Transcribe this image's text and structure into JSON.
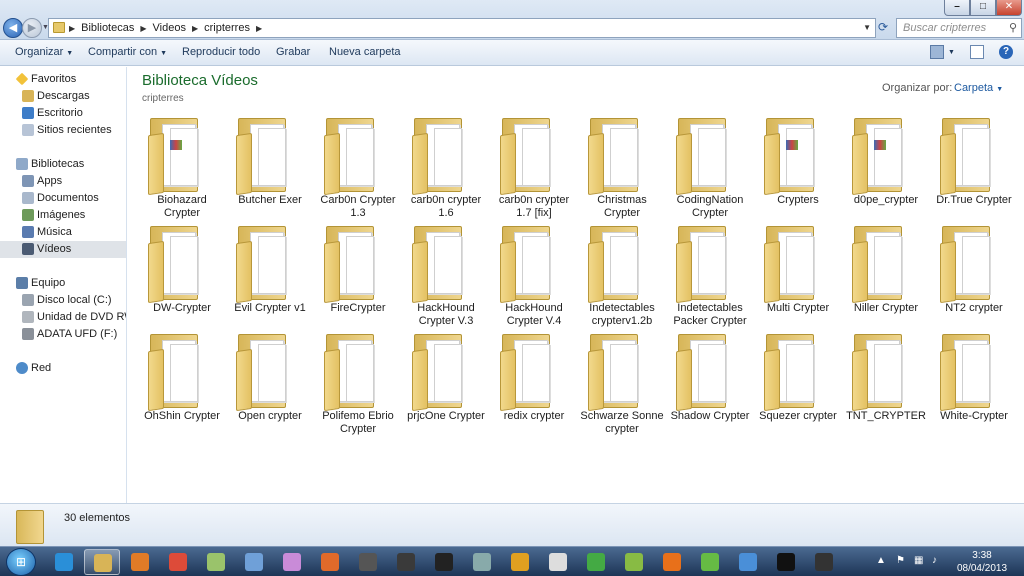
{
  "window": {
    "breadcrumb": [
      "Bibliotecas",
      "Videos",
      "cripterres"
    ],
    "search_placeholder": "Buscar cripterres",
    "controls": {
      "minimize": "–",
      "maximize": "□",
      "close": "✕"
    }
  },
  "toolbar": {
    "organize": "Organizar",
    "share": "Compartir con",
    "play_all": "Reproducir todo",
    "burn": "Grabar",
    "new_folder": "Nueva carpeta"
  },
  "nav": {
    "favorites_header": "Favoritos",
    "favorites": [
      "Descargas",
      "Escritorio",
      "Sitios recientes"
    ],
    "libraries_header": "Bibliotecas",
    "libraries": [
      "Apps",
      "Documentos",
      "Imágenes",
      "Música",
      "Vídeos"
    ],
    "computer_header": "Equipo",
    "drives": [
      "Disco local (C:)",
      "Unidad de DVD RW (",
      "ADATA UFD (F:)"
    ],
    "network": "Red"
  },
  "library": {
    "title": "Biblioteca Vídeos",
    "subtitle": "cripterres",
    "arrange_label": "Organizar por:",
    "arrange_value": "Carpeta"
  },
  "folders": [
    {
      "line1": "Biohazard",
      "line2": "Crypter",
      "thumb": "image"
    },
    {
      "line1": "Butcher Exer",
      "line2": "",
      "thumb": "docs"
    },
    {
      "line1": "Carb0n Crypter",
      "line2": "1.3",
      "thumb": "docs"
    },
    {
      "line1": "carb0n crypter",
      "line2": "1.6",
      "thumb": "docs"
    },
    {
      "line1": "carb0n crypter",
      "line2": "1.7 [fix]",
      "thumb": "docs"
    },
    {
      "line1": "Christmas",
      "line2": "Crypter",
      "thumb": "docs"
    },
    {
      "line1": "CodingNation",
      "line2": "Crypter",
      "thumb": "docs"
    },
    {
      "line1": "Crypters",
      "line2": "",
      "thumb": "image"
    },
    {
      "line1": "d0pe_crypter",
      "line2": "",
      "thumb": "image"
    },
    {
      "line1": "Dr.True Crypter",
      "line2": "",
      "thumb": "docs"
    },
    {
      "line1": "DW-Crypter",
      "line2": "",
      "thumb": "docs"
    },
    {
      "line1": "Evil Crypter v1",
      "line2": "",
      "thumb": "docs"
    },
    {
      "line1": "FireCrypter",
      "line2": "",
      "thumb": "docs"
    },
    {
      "line1": "HackHound",
      "line2": "Crypter V.3",
      "thumb": "blank"
    },
    {
      "line1": "HackHound",
      "line2": "Crypter V.4",
      "thumb": "blank"
    },
    {
      "line1": "Indetectables",
      "line2": "crypterv1.2b",
      "thumb": "docs"
    },
    {
      "line1": "Indetectables",
      "line2": "Packer Crypter",
      "thumb": "docs"
    },
    {
      "line1": "Multi Crypter",
      "line2": "",
      "thumb": "docs"
    },
    {
      "line1": "Niller Crypter",
      "line2": "",
      "thumb": "blank"
    },
    {
      "line1": "NT2 crypter",
      "line2": "",
      "thumb": "docs"
    },
    {
      "line1": "OhShin Crypter",
      "line2": "",
      "thumb": "docs"
    },
    {
      "line1": "Open crypter",
      "line2": "",
      "thumb": "blank"
    },
    {
      "line1": "Polifemo Ebrio",
      "line2": "Crypter",
      "thumb": "docs"
    },
    {
      "line1": "prjcOne Crypter",
      "line2": "",
      "thumb": "blank"
    },
    {
      "line1": "redix crypter",
      "line2": "",
      "thumb": "blank"
    },
    {
      "line1": "Schwarze Sonne",
      "line2": "crypter",
      "thumb": "blank"
    },
    {
      "line1": "Shadow Crypter",
      "line2": "",
      "thumb": "docs"
    },
    {
      "line1": "Squezer crypter",
      "line2": "",
      "thumb": "docs"
    },
    {
      "line1": "TNT_CRYPTER",
      "line2": "",
      "thumb": "docs"
    },
    {
      "line1": "White-Crypter",
      "line2": "",
      "thumb": "docs"
    }
  ],
  "status": {
    "count": "30 elementos"
  },
  "taskbar": {
    "apps": [
      "ie-icon",
      "explorer-icon",
      "media-player-icon",
      "chrome-icon",
      "notes-icon",
      "vpn-icon",
      "paint-icon",
      "game-icon",
      "tool-icon",
      "app-icon",
      "ghost-icon",
      "app-icon",
      "star-icon",
      "app-icon",
      "app-icon",
      "app-icon",
      "firefox-icon",
      "app-icon",
      "app-icon",
      "cmd-icon",
      "recorder-icon"
    ],
    "time": "3:38",
    "date": "08/04/2013"
  }
}
